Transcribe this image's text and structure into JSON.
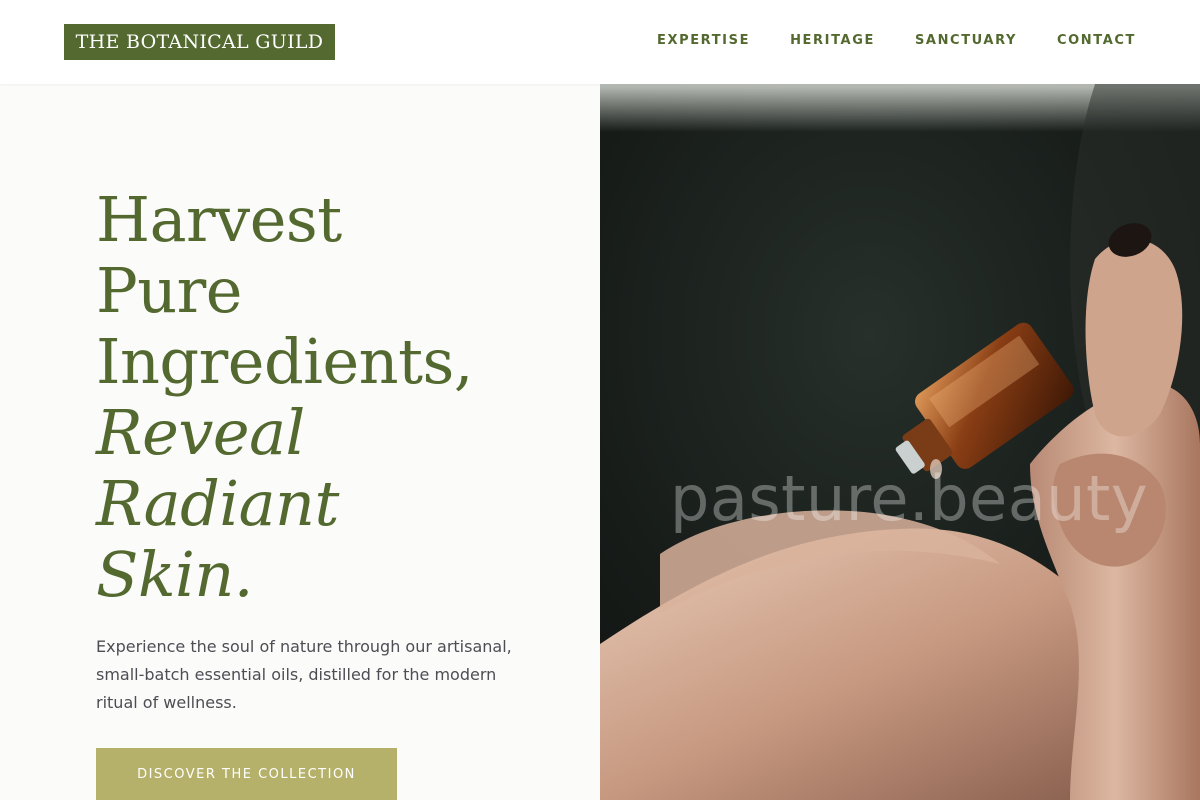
{
  "brand": {
    "logo_text": "THE BOTANICAL GUILD",
    "primary_color": "#53692f",
    "accent_color": "#b5b16a"
  },
  "nav": {
    "items": [
      {
        "label": "EXPERTISE"
      },
      {
        "label": "HERITAGE"
      },
      {
        "label": "SANCTUARY"
      },
      {
        "label": "CONTACT"
      }
    ]
  },
  "hero": {
    "headline_lines": [
      "Harvest",
      "Pure",
      "Ingredients,"
    ],
    "headline_italic_lines": [
      "Reveal",
      "Radiant",
      "Skin."
    ],
    "subtext": "Experience the soul of nature through our artisanal, small-batch essential oils, distilled for the modern ritual of wellness.",
    "cta_label": "DISCOVER THE COLLECTION",
    "image": {
      "description_icon": "essential-oil-dropper-photo",
      "watermark": "pasture.beauty"
    }
  }
}
